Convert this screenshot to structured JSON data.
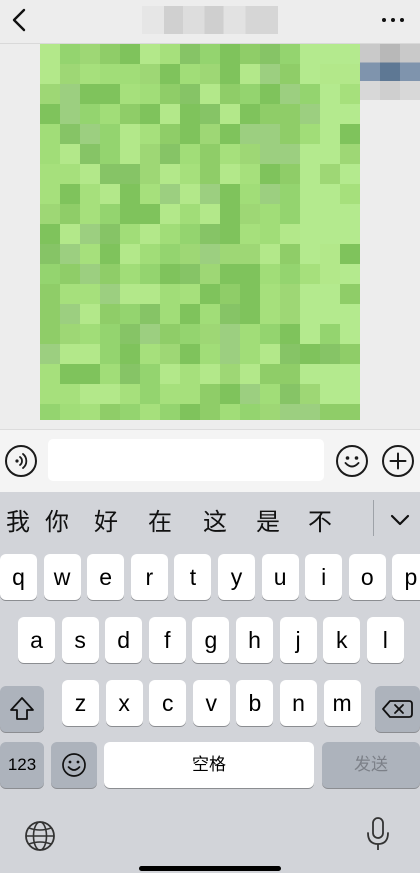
{
  "header": {
    "back_icon": "chevron-left-icon",
    "more_icon": "more-horizontal-icon"
  },
  "chat": {
    "bubble_color": "#a5e07c"
  },
  "input_bar": {
    "voice_icon": "voice-icon",
    "emoji_icon": "emoji-icon",
    "add_icon": "plus-circle-icon",
    "value": ""
  },
  "keyboard": {
    "candidates": [
      "我",
      "你",
      "好",
      "在",
      "这",
      "是",
      "不"
    ],
    "row1": [
      "q",
      "w",
      "e",
      "r",
      "t",
      "y",
      "u",
      "i",
      "o",
      "p"
    ],
    "row2": [
      "a",
      "s",
      "d",
      "f",
      "g",
      "h",
      "j",
      "k",
      "l"
    ],
    "row3": [
      "z",
      "x",
      "c",
      "v",
      "b",
      "n",
      "m"
    ],
    "numbers_label": "123",
    "space_label": "空格",
    "send_label": "发送"
  }
}
